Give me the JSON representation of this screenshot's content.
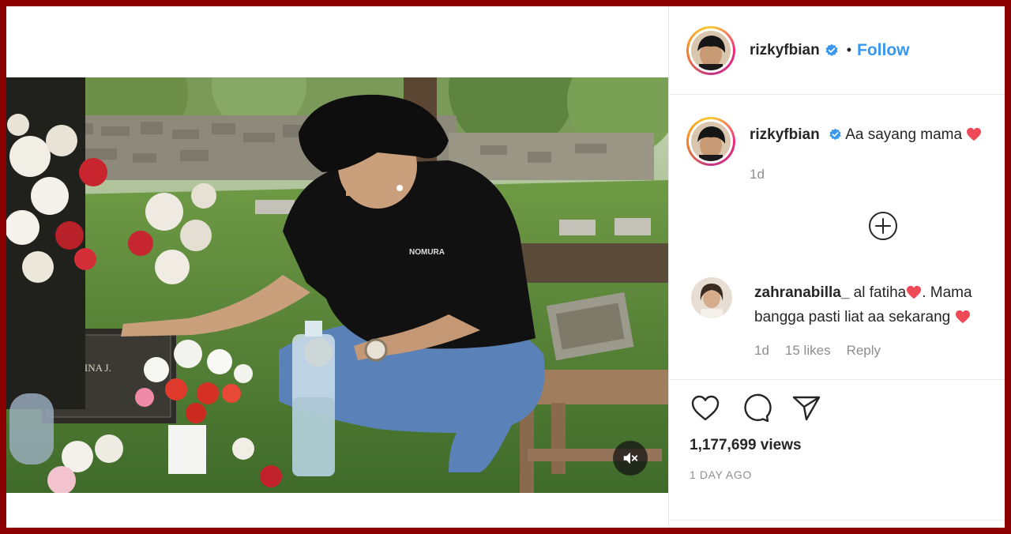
{
  "post": {
    "username": "rizkyfbian",
    "follow_label": "Follow",
    "separator": "•"
  },
  "caption": {
    "username": "rizkyfbian",
    "text": "Aa sayang mama",
    "time": "1d"
  },
  "comments": [
    {
      "username": "zahranabilla_",
      "text_line1": "al fatiha",
      "text_line1_after": ". Mama",
      "text_line2": "bangga pasti liat aa sekarang",
      "time": "1d",
      "likes": "15 likes",
      "reply_label": "Reply"
    }
  ],
  "stats": {
    "views": "1,177,699 views",
    "posted": "1 DAY AGO"
  },
  "colors": {
    "follow": "#3897f0",
    "verified": "#3897f0",
    "heart": "#ed4956",
    "frame": "#8b0000"
  },
  "icons": {
    "like": "heart-icon",
    "comment": "comment-icon",
    "share": "paper-plane-icon",
    "load_more": "plus-circle-icon",
    "mute": "speaker-muted-icon"
  }
}
